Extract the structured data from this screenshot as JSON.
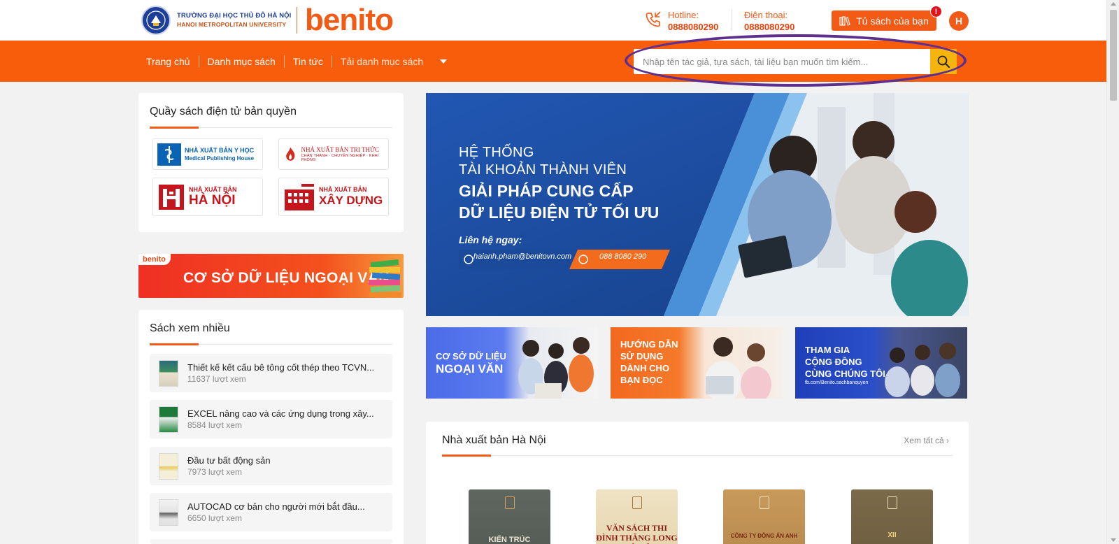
{
  "header": {
    "university_line1": "TRƯỜNG ĐẠI HỌC THỦ ĐÔ HÀ NỘI",
    "university_line2": "HANOI METROPOLITAN UNIVERSITY",
    "brand": "benito",
    "hotline_label": "Hotline:",
    "hotline_value": "0888080290",
    "phone_label": "Điện thoại:",
    "phone_value": "0888080290",
    "shelf_button": "Tủ sách của bạn",
    "notification_badge": "!",
    "avatar_initial": "H"
  },
  "nav": {
    "items": [
      "Trang chủ",
      "Danh mục sách",
      "Tin tức"
    ],
    "download": "Tải danh mục sách"
  },
  "search": {
    "placeholder": "Nhập tên tác giả, tựa sách, tài liệu bạn muốn tìm kiếm...",
    "value": ""
  },
  "left": {
    "publishers_title": "Quầy sách điện tử bản quyền",
    "publishers": [
      {
        "l1": "NHÀ XUẤT BẢN Y HỌC",
        "l2": "Medical Publishing House"
      },
      {
        "l1": "NHÀ XUẤT BẢN TRI THỨC",
        "l2": "CHÂN THÀNH · CHUYÊN NGHIỆP · KHAI PHÓNG"
      },
      {
        "l1": "NHÀ XUẤT BẢN",
        "l2": "HÀ NỘI"
      },
      {
        "l1": "NHÀ XUẤT BẢN",
        "l2": "XÂY DỰNG"
      }
    ],
    "db_banner_tag": "benito",
    "db_banner_text": "CƠ SỞ DỮ LIỆU NGOẠI VĂN",
    "popular_title": "Sách xem nhiều",
    "popular_books": [
      {
        "title": "Thiết kế kết cấu bê tông cốt thép theo TCVN...",
        "views": "11637 lượt xem"
      },
      {
        "title": "EXCEL nâng cao và các ứng dụng trong xây...",
        "views": "8584 lượt xem"
      },
      {
        "title": "Đầu tư bất động sản",
        "views": "7973 lượt xem"
      },
      {
        "title": "AUTOCAD cơ bản cho người mới bắt đầu...",
        "views": "6650 lượt xem"
      }
    ]
  },
  "hero": {
    "line1": "HỆ THỐNG",
    "line2": "TÀI KHOẢN THÀNH VIÊN",
    "line3": "GIẢI PHÁP CUNG CẤP",
    "line4": "DỮ LIỆU ĐIỆN TỬ TỐI ƯU",
    "contact_label": "Liên hệ ngay:",
    "email": "haianh.pham@benitovn.com",
    "phone": "088 8080 290"
  },
  "promos": [
    {
      "line1": "CƠ SỞ DỮ LIỆU",
      "line2": "NGOẠI VĂN"
    },
    {
      "line1": "HƯỚNG DẪN",
      "line2": "SỬ DỤNG",
      "line3": "DÀNH CHO",
      "line4": "BẠN ĐỌC"
    },
    {
      "line1": "THAM GIA",
      "line2": "CỘNG ĐỒNG",
      "line3": "CÙNG CHÚNG TÔI",
      "line4": "fb.com/Benito.sachbanquyen"
    }
  ],
  "section": {
    "title": "Nhà xuất bản Hà Nội",
    "see_all": "Xem tất cả",
    "covers": [
      {
        "text": "KIẾN TRÚC"
      },
      {
        "text": "VĂN SÁCH THI ĐÌNH THĂNG LONG - HÀ NỘI"
      },
      {
        "text": "CÔNG TY ĐÔNG ẤN ANH"
      },
      {
        "text": "XII"
      }
    ]
  },
  "colors": {
    "brand_orange": "#f85d0b",
    "search_button": "#f6b40e",
    "highlight_ring": "#5d2f8f",
    "hero_blue": "#1e4fa3"
  }
}
